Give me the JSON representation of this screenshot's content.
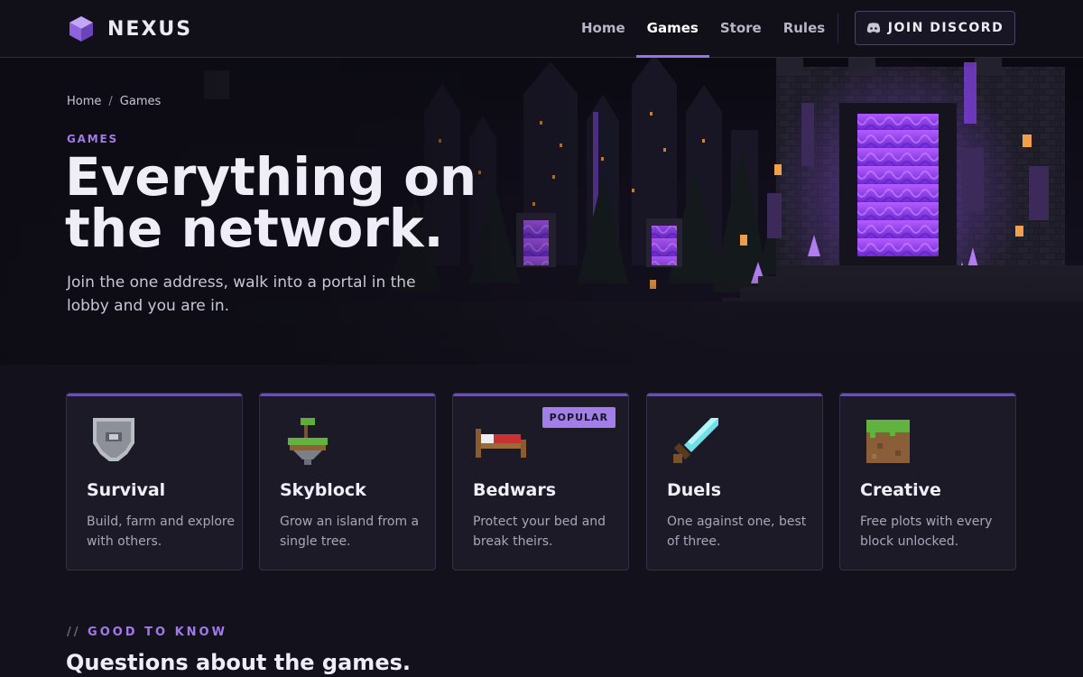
{
  "brand": {
    "name": "NEXUS",
    "logo_icon": "cube-icon",
    "accent": "#9a72e6"
  },
  "nav": {
    "links": [
      {
        "label": "Home",
        "active": false
      },
      {
        "label": "Games",
        "active": true
      },
      {
        "label": "Store",
        "active": false
      },
      {
        "label": "Rules",
        "active": false
      }
    ],
    "discord_label": "JOIN DISCORD",
    "discord_icon": "discord-icon"
  },
  "hero": {
    "breadcrumb": [
      "Home",
      "Games"
    ],
    "breadcrumb_separator": "/",
    "eyebrow": "GAMES",
    "title": "Everything on the network.",
    "subtitle": "Join the one address, walk into a portal in the lobby and you are in."
  },
  "games": [
    {
      "title": "Survival",
      "description": "Build, farm and explore with others.",
      "icon": "shield-icon"
    },
    {
      "title": "Skyblock",
      "description": "Grow an island from a single tree.",
      "icon": "floating-island-icon"
    },
    {
      "title": "Bedwars",
      "description": "Protect your bed and break theirs.",
      "icon": "bed-icon",
      "badge": "POPULAR"
    },
    {
      "title": "Duels",
      "description": "One against one, best of three.",
      "icon": "sword-icon"
    },
    {
      "title": "Creative",
      "description": "Free plots with every block unlocked.",
      "icon": "grass-block-icon"
    }
  ],
  "faq": {
    "eyebrow_prefix": "//",
    "eyebrow": "GOOD TO KNOW",
    "title": "Questions about the games."
  }
}
